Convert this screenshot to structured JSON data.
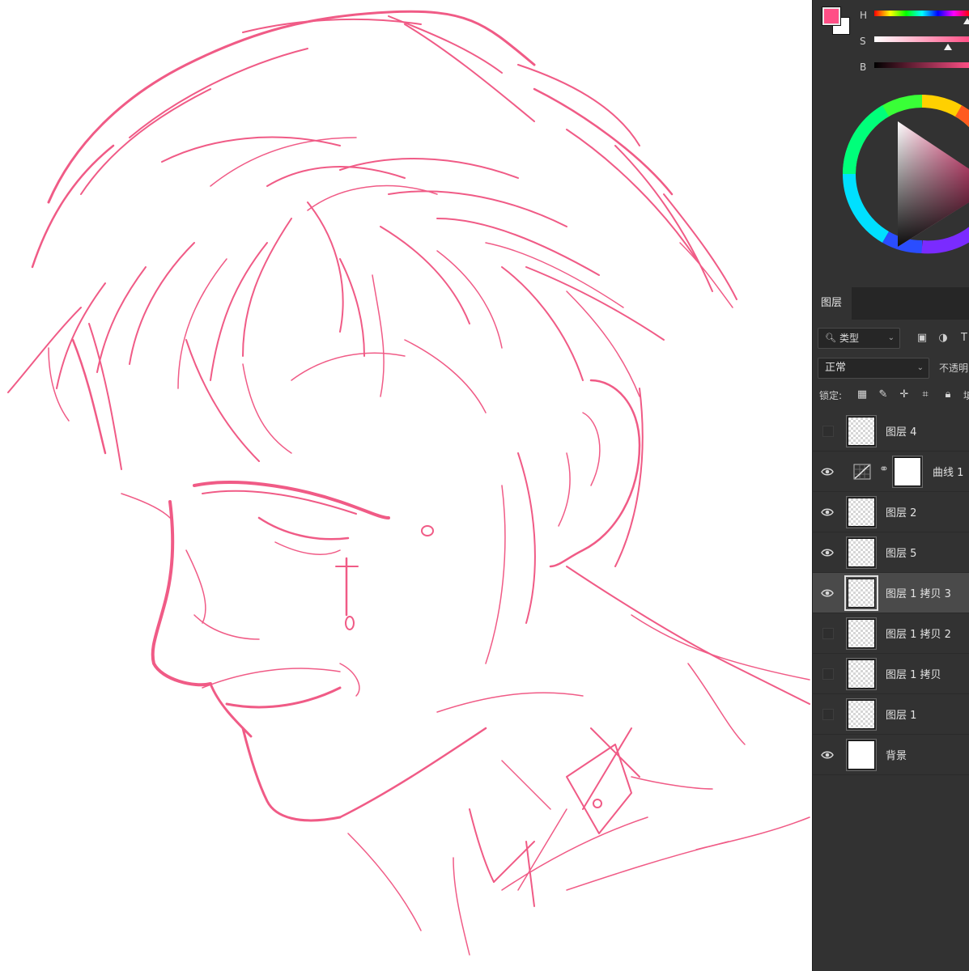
{
  "colors": {
    "foreground": "#ff4f86",
    "background": "#ffffff",
    "ink": "#ee3f72",
    "panel": "#323232"
  },
  "color_panel": {
    "h_label": "H",
    "s_label": "S",
    "b_label": "B"
  },
  "layers_panel": {
    "tab_label": "图层",
    "kind_filter": "类型",
    "blend_mode": "正常",
    "opacity_label": "不透明",
    "lock_label": "锁定:",
    "fill_label": "填",
    "layers": [
      {
        "name": "图层 4",
        "visible": false,
        "type": "pixel"
      },
      {
        "name": "曲线 1",
        "visible": true,
        "type": "curves-adjustment"
      },
      {
        "name": "图层 2",
        "visible": true,
        "type": "pixel"
      },
      {
        "name": "图层 5",
        "visible": true,
        "type": "pixel"
      },
      {
        "name": "图层 1 拷贝 3",
        "visible": true,
        "type": "pixel",
        "selected": true
      },
      {
        "name": "图层 1 拷贝 2",
        "visible": false,
        "type": "pixel"
      },
      {
        "name": "图层 1 拷贝",
        "visible": false,
        "type": "pixel"
      },
      {
        "name": "图层 1",
        "visible": false,
        "type": "pixel"
      },
      {
        "name": "背景",
        "visible": true,
        "type": "background"
      }
    ]
  }
}
